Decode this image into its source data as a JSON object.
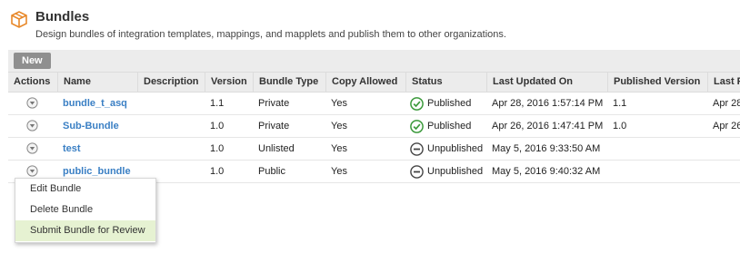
{
  "header": {
    "title": "Bundles",
    "subtitle": "Design bundles of integration templates, mappings, and mapplets and publish them to other organizations.",
    "icon": "package-box-icon"
  },
  "toolbar": {
    "new_label": "New"
  },
  "table": {
    "columns": [
      "Actions",
      "Name",
      "Description",
      "Version",
      "Bundle Type",
      "Copy Allowed",
      "Status",
      "Last Updated On",
      "Published Version",
      "Last P"
    ],
    "rows": [
      {
        "name": "bundle_t_asq",
        "description": "",
        "version": "1.1",
        "type": "Private",
        "copy": "Yes",
        "status": "Published",
        "status_icon": "check-circle-icon",
        "updated": "Apr 28, 2016 1:57:14 PM",
        "pub_version": "1.1",
        "last_pub": "Apr 28"
      },
      {
        "name": "Sub-Bundle",
        "description": "",
        "version": "1.0",
        "type": "Private",
        "copy": "Yes",
        "status": "Published",
        "status_icon": "check-circle-icon",
        "updated": "Apr 26, 2016 1:47:41 PM",
        "pub_version": "1.0",
        "last_pub": "Apr 26"
      },
      {
        "name": "test",
        "description": "",
        "version": "1.0",
        "type": "Unlisted",
        "copy": "Yes",
        "status": "Unpublished",
        "status_icon": "minus-circle-icon",
        "updated": "May 5, 2016 9:33:50 AM",
        "pub_version": "",
        "last_pub": ""
      },
      {
        "name": "public_bundle",
        "description": "",
        "version": "1.0",
        "type": "Public",
        "copy": "Yes",
        "status": "Unpublished",
        "status_icon": "minus-circle-icon",
        "updated": "May 5, 2016 9:40:32 AM",
        "pub_version": "",
        "last_pub": ""
      }
    ]
  },
  "menu": {
    "items": [
      "Edit Bundle",
      "Delete Bundle",
      "Submit Bundle for Review"
    ],
    "highlighted": "Submit Bundle for Review"
  },
  "colors": {
    "link": "#3a7fc4",
    "published": "#3c9a3c",
    "unpublished": "#444444",
    "menu_highlight": "#e6f2d2",
    "header_bg": "#ececec",
    "icon_orange": "#e8882a"
  }
}
